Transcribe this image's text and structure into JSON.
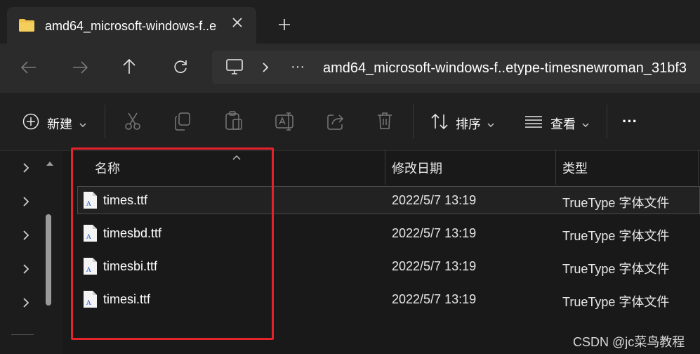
{
  "tab": {
    "title": "amd64_microsoft-windows-f..e",
    "icon": "folder-icon"
  },
  "nav": {
    "address": "amd64_microsoft-windows-f..etype-timesnewroman_31bf3",
    "more": "···"
  },
  "commands": {
    "new_label": "新建",
    "sort_label": "排序",
    "view_label": "查看",
    "more": "···"
  },
  "columns": {
    "name": "名称",
    "modified": "修改日期",
    "type": "类型"
  },
  "files": [
    {
      "name": "times.ttf",
      "modified": "2022/5/7 13:19",
      "type": "TrueType 字体文件"
    },
    {
      "name": "timesbd.ttf",
      "modified": "2022/5/7 13:19",
      "type": "TrueType 字体文件"
    },
    {
      "name": "timesbi.ttf",
      "modified": "2022/5/7 13:19",
      "type": "TrueType 字体文件"
    },
    {
      "name": "timesi.ttf",
      "modified": "2022/5/7 13:19",
      "type": "TrueType 字体文件"
    }
  ],
  "watermark": "CSDN @jc菜鸟教程",
  "colors": {
    "highlight": "#e5232b",
    "background": "#191919",
    "folder": "#f0c24b"
  }
}
